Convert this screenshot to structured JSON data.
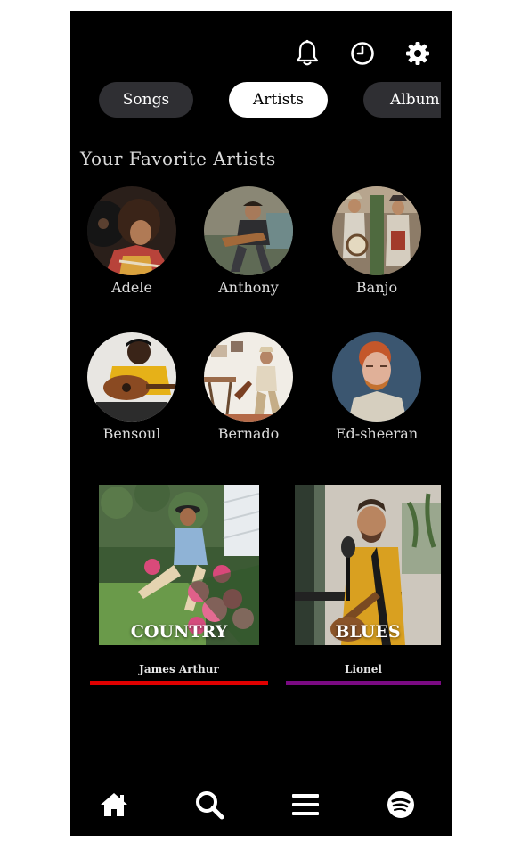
{
  "header": {
    "icons": [
      "bell-icon",
      "history-icon",
      "gear-icon"
    ]
  },
  "tabs": [
    {
      "label": "Songs",
      "active": false
    },
    {
      "label": "Artists",
      "active": true
    },
    {
      "label": "Album",
      "active": false
    }
  ],
  "section_title": "Your Favorite Artists",
  "artists": [
    {
      "name": "Adele"
    },
    {
      "name": "Anthony"
    },
    {
      "name": "Banjo"
    },
    {
      "name": "Bensoul"
    },
    {
      "name": "Bernado"
    },
    {
      "name": "Ed-sheeran"
    }
  ],
  "genre_cards": [
    {
      "genre": "COUNTRY",
      "artist": "James Arthur",
      "bar_color": "#e00000"
    },
    {
      "genre": "BLUES",
      "artist": "Lionel",
      "bar_color": "#7a0a82"
    }
  ],
  "bottom_nav": {
    "icons": [
      "home-icon",
      "search-icon",
      "menu-icon",
      "spotify-icon"
    ]
  },
  "colors": {
    "background": "#000000",
    "tab_inactive": "#2f2f33",
    "tab_active": "#ffffff"
  }
}
